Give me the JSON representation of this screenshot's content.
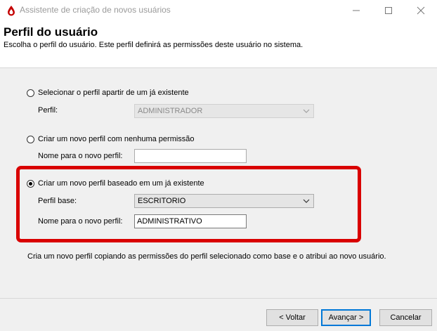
{
  "window": {
    "title": "Assistente de criação de novos usuários",
    "accent_color": "#cc0000"
  },
  "header": {
    "title": "Perfil do usuário",
    "subtitle": "Escolha o perfil do usuário. Este perfil definirá as permissões deste usuário no sistema."
  },
  "options": {
    "existing": {
      "label": "Selecionar o perfil apartir de um já existente",
      "selected": false,
      "profile_label": "Perfil:",
      "profile_value": "ADMINISTRADOR"
    },
    "empty": {
      "label": "Criar um novo perfil com nenhuma permissão",
      "selected": false,
      "name_label": "Nome para o novo perfil:",
      "name_value": ""
    },
    "based": {
      "label": "Criar um novo perfil baseado em um já existente",
      "selected": true,
      "base_label": "Perfil base:",
      "base_value": "ESCRITORIO",
      "name_label": "Nome para o novo perfil:",
      "name_value": "ADMINISTRATIVO"
    }
  },
  "description": "Cria um novo perfil copiando as permissões do perfil selecionado como base e o atribui ao novo usuário.",
  "buttons": {
    "back": "< Voltar",
    "next": "Avançar >",
    "cancel": "Cancelar"
  }
}
